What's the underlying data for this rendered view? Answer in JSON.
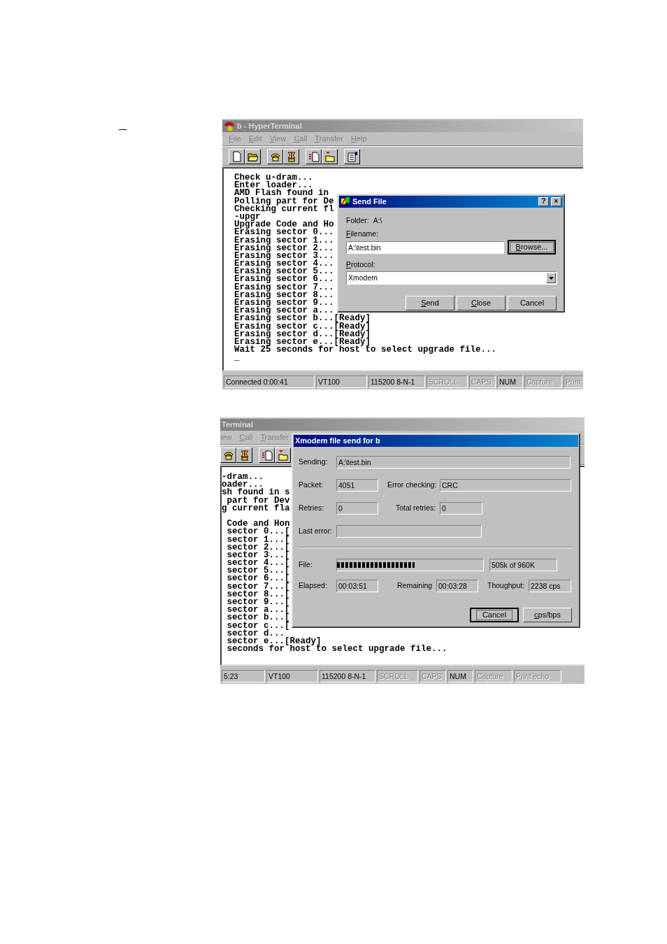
{
  "windows": [
    {
      "title": "b - HyperTerminal",
      "active": false,
      "show_icon": true,
      "menu": [
        {
          "label": "File",
          "underlined": true
        },
        {
          "label": "Edit",
          "underlined": true
        },
        {
          "label": "View",
          "underlined": true
        },
        {
          "label": "Call",
          "underlined": true
        },
        {
          "label": "Transfer",
          "underlined": true
        },
        {
          "label": "Help",
          "underlined": true
        }
      ],
      "toolbar": [
        {
          "kind": "new"
        },
        {
          "kind": "open"
        },
        {
          "kind": "gap"
        },
        {
          "kind": "dial"
        },
        {
          "kind": "hangup"
        },
        {
          "kind": "gap"
        },
        {
          "kind": "send"
        },
        {
          "kind": "receive"
        },
        {
          "kind": "gap"
        },
        {
          "kind": "properties"
        }
      ],
      "terminal_blocks": [
        [
          "Check u-dram...",
          "Enter loader...",
          "AMD Flash found in",
          "Polling part for De",
          "Checking current fl",
          "-upgr",
          "Upgrade Code and Ho",
          "Erasing sector 0...",
          "Erasing sector 1...",
          "Erasing sector 2...",
          "Erasing sector 3...",
          "Erasing sector 4...",
          "Erasing sector 5...",
          "Erasing sector 6...",
          "Erasing sector 7...",
          "Erasing sector 8...",
          "Erasing sector 9...",
          "Erasing sector a...",
          "Erasing sector b...[Ready]",
          "Erasing sector c...[Ready]",
          "Erasing sector d...[Ready]",
          "Erasing sector e...[Ready]",
          "Wait 25 seconds for host to select upgrade file...",
          "_"
        ]
      ],
      "status_bar": [
        {
          "text": "Connected 0:00:41",
          "on": true
        },
        {
          "text": "VT100",
          "on": true
        },
        {
          "text": "115200 8-N-1",
          "on": true
        },
        {
          "text": "SCROLL",
          "on": false
        },
        {
          "text": "CAPS",
          "on": false
        },
        {
          "text": "NUM",
          "on": true
        },
        {
          "text": "Capture",
          "on": false
        },
        {
          "text": "Print",
          "on": false
        }
      ],
      "dialog": {
        "kind": "send_file",
        "title": "Send File",
        "title_buttons": [
          "?",
          "×"
        ],
        "folder_label": "Folder:",
        "folder": "A:\\",
        "filename_label": "Filename:",
        "filename": "A:\\test.bin",
        "browse": {
          "label": "Browse...",
          "focused": true,
          "underlined": true
        },
        "protocol_label": "Protocol:",
        "protocol": "Xmodem",
        "buttons": [
          {
            "label": "Send",
            "focused": false,
            "underlined": true
          },
          {
            "label": "Close",
            "focused": false,
            "underlined": true
          },
          {
            "label": "Cancel",
            "focused": false,
            "underlined": false
          }
        ]
      }
    },
    {
      "title": "Terminal",
      "active": false,
      "show_icon": false,
      "menu": [
        {
          "label": "iew",
          "underlined": false
        },
        {
          "label": "Call",
          "underlined": true
        },
        {
          "label": "Transfer",
          "underlined": true
        }
      ],
      "toolbar": [
        {
          "kind": "dial"
        },
        {
          "kind": "hangup"
        },
        {
          "kind": "gap"
        },
        {
          "kind": "send"
        },
        {
          "kind": "receive"
        }
      ],
      "terminal_blocks": [
        [
          "-dram...",
          "oader...",
          "sh found in s",
          " part for Dev",
          "g current fla"
        ],
        [
          " Code and Hon",
          " sector 0...[",
          " sector 1...[",
          " sector 2...[",
          " sector 3...[",
          " sector 4...[",
          " sector 5...[",
          " sector 6...[",
          " sector 7...[",
          " sector 8...[",
          " sector 9...[",
          " sector a...[",
          " sector b...[",
          " sector c...[",
          " sector d...",
          " sector e...[Ready]",
          " seconds for host to select upgrade file..."
        ]
      ],
      "status_bar": [
        {
          "text": "5:23",
          "on": true
        },
        {
          "text": "VT100",
          "on": true
        },
        {
          "text": "115200 8-N-1",
          "on": true
        },
        {
          "text": "SCROLL",
          "on": false
        },
        {
          "text": "CAPS",
          "on": false
        },
        {
          "text": "NUM",
          "on": true
        },
        {
          "text": "Capture",
          "on": false
        },
        {
          "text": "Print echo",
          "on": false
        }
      ],
      "dialog": {
        "kind": "transfer_progress",
        "title": "Xmodem file send for b",
        "rows": [
          [
            {
              "label": "Sending:",
              "value": "A:\\test.bin"
            }
          ],
          [
            {
              "label": "Packet:",
              "value": "4051"
            },
            {
              "label": "Error checking:",
              "value": "CRC"
            }
          ],
          [
            {
              "label": "Retries:",
              "value": "0"
            },
            {
              "label": "Total retries:",
              "value": "0"
            }
          ],
          [
            {
              "label": "Last error:"
            }
          ]
        ],
        "file": {
          "label": "File:",
          "level": 0.53,
          "size": "505k of 960K"
        },
        "times": [
          {
            "label": "Elapsed:",
            "value": "00:03:51"
          },
          {
            "label": "Remaining",
            "value": "00:03:28"
          },
          {
            "label": "Thoughput:",
            "value": "2238 cps"
          }
        ],
        "buttons": [
          {
            "label": "Cancel",
            "focused": true,
            "underlined": false
          },
          {
            "label": "cps/bps",
            "focused": false,
            "underlined": true
          }
        ]
      }
    }
  ]
}
